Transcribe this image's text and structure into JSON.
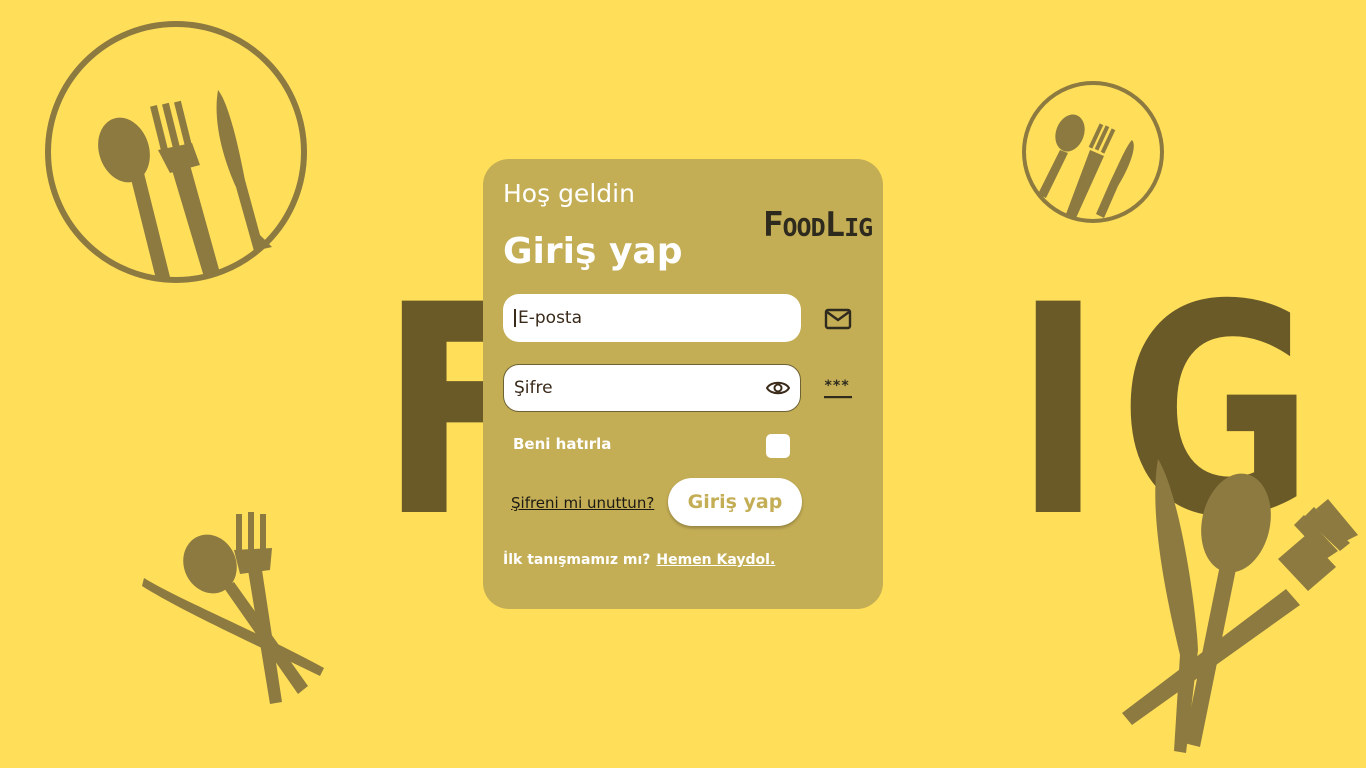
{
  "background": {
    "color": "#FFDE59",
    "word": "FOODLIG",
    "word_color": "#6A5A28"
  },
  "card": {
    "color": "#C4AE55",
    "welcome": "Hoş geldin",
    "title": "Giriş yap",
    "brand": {
      "big1": "F",
      "small1": "OOD",
      "big2": "L",
      "small2": "IG"
    }
  },
  "form": {
    "email_placeholder": "E-posta",
    "password_placeholder": "Şifre",
    "remember_label": "Beni hatırla",
    "forgot_label": "Şifreni mi unuttun?",
    "submit_label": "Giriş yap",
    "signup_prompt": "İlk tanışmamız mı?",
    "signup_link": "Hemen Kaydol."
  },
  "icons": {
    "email": "mail-icon",
    "visibility": "eye-icon",
    "password": "asterisks-icon",
    "decor": "cutlery-icon"
  }
}
